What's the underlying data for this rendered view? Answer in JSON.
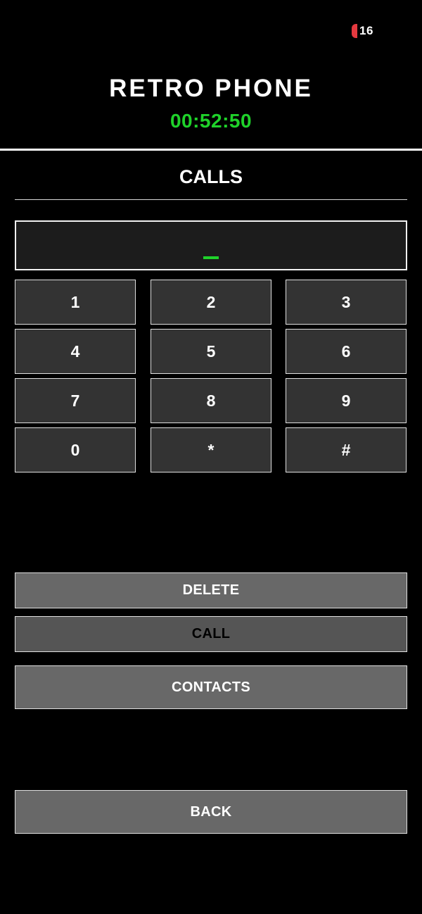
{
  "status_bar": {
    "battery_level": "16",
    "battery_color": "#e5393f"
  },
  "header": {
    "title": "RETRO PHONE",
    "clock": "00:52:50",
    "clock_color": "#1fd22a"
  },
  "section": {
    "title": "CALLS"
  },
  "display": {
    "value": "",
    "cursor": "_"
  },
  "keypad": {
    "keys": [
      "1",
      "2",
      "3",
      "4",
      "5",
      "6",
      "7",
      "8",
      "9",
      "0",
      "*",
      "#"
    ]
  },
  "actions": {
    "delete_label": "DELETE",
    "call_label": "CALL",
    "contacts_label": "CONTACTS",
    "back_label": "BACK"
  }
}
